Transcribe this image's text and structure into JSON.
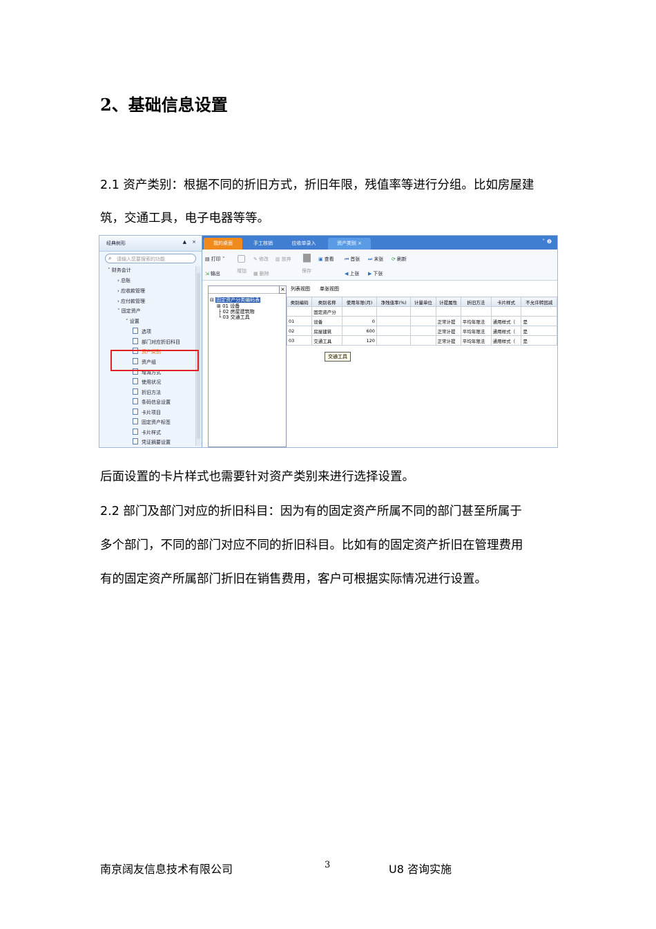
{
  "heading": "2、基础信息设置",
  "para1": "2.1 资产类别：根据不同的折旧方式，折旧年限，残值率等进行分组。比如房屋建",
  "para1b": "筑，交通工具，电子电器等等。",
  "para2": "后面设置的卡片样式也需要针对资产类别来进行选择设置。",
  "para3a": "2.2 部门及部门对应的折旧科目：因为有的固定资产所属不同的部门甚至所属于",
  "para3b": "多个部门，不同的部门对应不同的折旧科目。比如有的固定资产折旧在管理费用",
  "para3c": "有的固定资产所属部门折旧在销售费用，客户可根据实际情况进行设置。",
  "footer": {
    "company": "南京阔友信息技术有限公司",
    "page": "3",
    "right": "U8 咨询实施"
  },
  "shot": {
    "left_panel": {
      "title": "经典树形",
      "pin": "📌",
      "close": "×",
      "search_placeholder": "请输入您要搜索的功能",
      "tree": [
        "财务会计",
        "总账",
        "应收款管理",
        "应付款管理",
        "固定资产",
        "设置",
        "选项",
        "部门对应折旧科目",
        "资产类别",
        "资产组",
        "增减方式",
        "使用状况",
        "折旧方法",
        "条码信息设置",
        "卡片项目",
        "固定资产标签",
        "卡片样式",
        "凭证摘要设置"
      ]
    },
    "tabs": [
      "我的桌面",
      "手工核销",
      "应收单录入",
      "资产类别"
    ],
    "toolbar": {
      "print": "打印",
      "output": "输出",
      "add": "增加",
      "modify": "修改",
      "discard": "放弃",
      "delete": "删除",
      "save": "保存",
      "view": "查看",
      "first": "首张",
      "last": "末张",
      "refresh": "刷新",
      "prev": "上张",
      "next": "下张"
    },
    "tree_view": {
      "root": "固定资产分类编码表",
      "nodes": [
        "01 设备",
        "02 房屋建筑物",
        "03 交通工具"
      ]
    },
    "view_tabs": [
      "列表视图",
      "单张视图"
    ],
    "table": {
      "headers": [
        "类别编码",
        "类别名称",
        "使用年限(月)",
        "净残值率(%)",
        "计量单位",
        "计提属性",
        "折旧方法",
        "卡片样式",
        "不允许转回减"
      ],
      "rows": [
        [
          "",
          "固定资产分",
          "",
          "",
          "",
          "",
          "",
          "",
          ""
        ],
        [
          "01",
          "设备",
          "0",
          "",
          "",
          "正常计提",
          "平均年限法",
          "通用样式（",
          "是"
        ],
        [
          "02",
          "房屋建筑",
          "600",
          "",
          "",
          "正常计提",
          "平均年限法",
          "通用样式（",
          "是"
        ],
        [
          "03",
          "交通工具",
          "120",
          "",
          "",
          "正常计提",
          "平均年限法",
          "通用样式（",
          "是"
        ]
      ]
    },
    "tooltip": "交通工具"
  }
}
